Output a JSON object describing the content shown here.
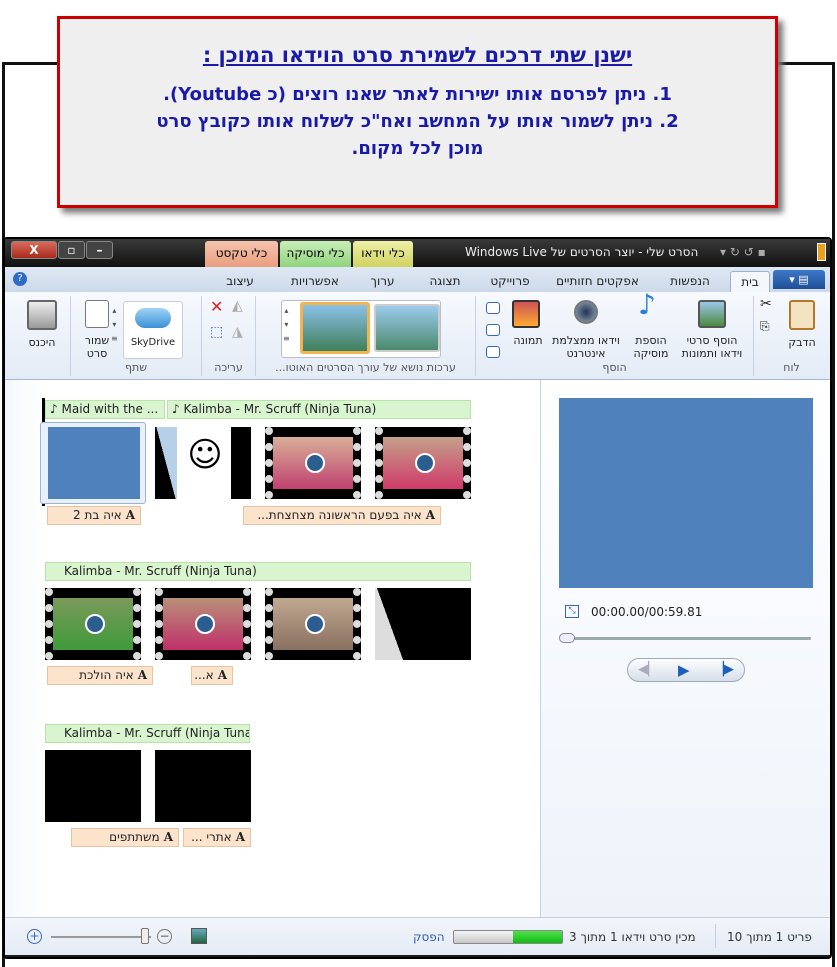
{
  "callout": {
    "title": "ישנן שתי דרכים לשמירת סרט הוידאו המוכן :",
    "line1": "1. ניתן לפרסם אותו ישירות לאתר שאנו רוצים (כ Youtube).",
    "line2": "2. ניתן לשמור אותו על המחשב ואח\"כ לשלוח אותו כקובץ סרט",
    "line3": "מוכן לכל מקום."
  },
  "window": {
    "title": "הסרט שלי - יוצר הסרטים של Windows Live",
    "close": "X"
  },
  "context_tabs": [
    {
      "label": "כלי טקסט",
      "color": "#f0a98a"
    },
    {
      "label": "כלי מוסיקה",
      "color": "#9edb8c"
    },
    {
      "label": "כלי וידאו",
      "color": "#dfe07a"
    }
  ],
  "tabs": [
    {
      "label": "בית",
      "selected": true
    },
    {
      "label": "הנפשות"
    },
    {
      "label": "אפקטים חזותיים"
    },
    {
      "label": "פרוייקט"
    },
    {
      "label": "תצוגה"
    },
    {
      "label": "ערוך"
    },
    {
      "label": "אפשרויות"
    },
    {
      "label": "עיצוב"
    }
  ],
  "ribbon": {
    "clipboard": {
      "label": "לוח",
      "paste": "הדבק"
    },
    "add": {
      "label": "הוסף",
      "add_videos": "הוסף סרטי וידאו ותמונות",
      "add_music": "הוספת מוסיקה",
      "webcam": "וידאו ממצלמת אינטרנט",
      "snapshot": "תמונה"
    },
    "themes": {
      "label": "ערכות נושא של עורך הסרטים האוטו..."
    },
    "editing": {
      "label": "עריכה"
    },
    "share": {
      "label": "שתף",
      "skydrive": "SkyDrive",
      "save_movie": "שמור סרט"
    },
    "signin": "היכנס"
  },
  "storyboard": {
    "rows": [
      {
        "music": [
          "Maid with the ...",
          "Kalimba - Mr. Scruff (Ninja Tuna)"
        ],
        "captions": [
          "איה בת 2",
          "איה בפעם הראשונה מצחצחת..."
        ]
      },
      {
        "music": [
          "Kalimba - Mr. Scruff (Ninja Tuna)"
        ],
        "captions": [
          "איה הולכת",
          "א..."
        ]
      },
      {
        "music": [
          "Kalimba - Mr. Scruff (Ninja Tuna)"
        ],
        "captions": [
          "משתתפים",
          "אתרי ..."
        ]
      }
    ]
  },
  "preview": {
    "time": "00:00.00/00:59.81",
    "color": "#4f81bd"
  },
  "status": {
    "item": "פריט 1 מתוך 10",
    "progress_text": "מכין סרט וידאו 1 מתוך 3",
    "progress_percent": 45,
    "stop": "הפסק"
  }
}
